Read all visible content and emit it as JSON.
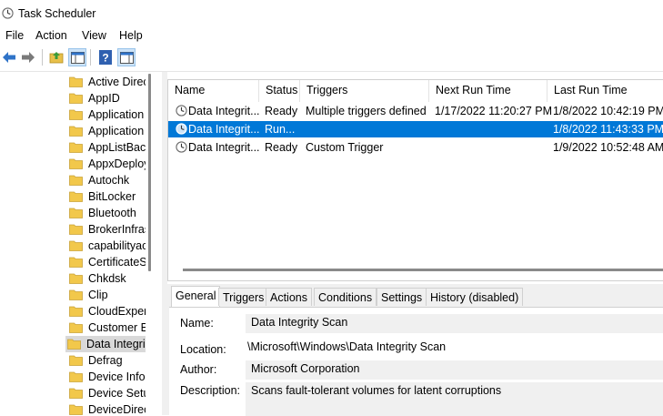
{
  "window": {
    "title": "Task Scheduler"
  },
  "menu": [
    "File",
    "Action",
    "View",
    "Help"
  ],
  "tree": {
    "items": [
      {
        "label": "Active Directory"
      },
      {
        "label": "AppID"
      },
      {
        "label": "Application"
      },
      {
        "label": "Application"
      },
      {
        "label": "AppListBac"
      },
      {
        "label": "AppxDeploy"
      },
      {
        "label": "Autochk"
      },
      {
        "label": "BitLocker"
      },
      {
        "label": "Bluetooth"
      },
      {
        "label": "BrokerInfras"
      },
      {
        "label": "capabilityac"
      },
      {
        "label": "CertificateS"
      },
      {
        "label": "Chkdsk"
      },
      {
        "label": "Clip"
      },
      {
        "label": "CloudExper"
      },
      {
        "label": "Customer E"
      },
      {
        "label": "Data Integri"
      },
      {
        "label": "Defrag"
      },
      {
        "label": "Device Info"
      },
      {
        "label": "Device Setu"
      },
      {
        "label": "DeviceDirec"
      }
    ],
    "selected_index": 16
  },
  "tasklist": {
    "columns": [
      "Name",
      "Status",
      "Triggers",
      "Next Run Time",
      "Last Run Time"
    ],
    "rows": [
      {
        "name": "Data Integrit...",
        "status": "Ready",
        "triggers": "Multiple triggers defined",
        "next_run": "1/17/2022 11:20:27 PM",
        "last_run": "1/8/2022 10:42:19 PM",
        "selected": false
      },
      {
        "name": "Data Integrit...",
        "status": "Run...",
        "triggers": "",
        "next_run": "",
        "last_run": "1/8/2022 11:43:33 PM",
        "selected": true
      },
      {
        "name": "Data Integrit...",
        "status": "Ready",
        "triggers": "Custom Trigger",
        "next_run": "",
        "last_run": "1/9/2022 10:52:48 AM",
        "selected": false
      }
    ]
  },
  "details": {
    "tabs": [
      "General",
      "Triggers",
      "Actions",
      "Conditions",
      "Settings",
      "History (disabled)"
    ],
    "active_tab": 0,
    "fields": {
      "name_label": "Name:",
      "name_value": "Data Integrity Scan",
      "location_label": "Location:",
      "location_value": "\\Microsoft\\Windows\\Data Integrity Scan",
      "author_label": "Author:",
      "author_value": "Microsoft Corporation",
      "description_label": "Description:",
      "description_value": "Scans fault-tolerant volumes for latent corruptions"
    }
  },
  "colors": {
    "selection": "#0078d7",
    "folder": "#f2c84b",
    "toolbar_arrow": "#2f73c8"
  },
  "icons": {
    "app": "clock-icon",
    "back": "back-arrow-icon",
    "forward": "forward-arrow-icon",
    "up": "up-folder-icon",
    "show_hide_tree": "show-hide-tree-icon",
    "help": "help-icon",
    "show_hide_action": "show-hide-action-pane-icon"
  }
}
